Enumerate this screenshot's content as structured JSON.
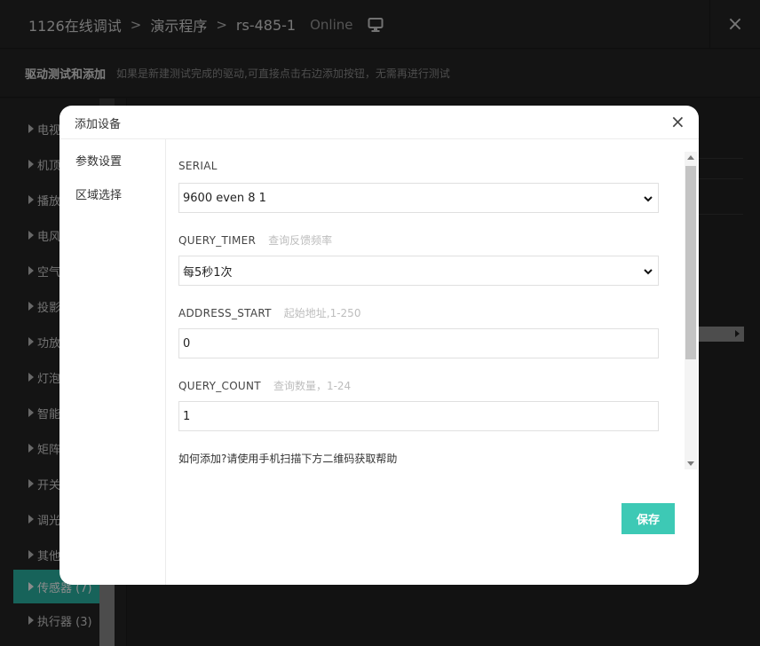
{
  "header": {
    "breadcrumb": [
      "1126在线调试",
      "演示程序",
      "rs-485-1"
    ],
    "status": "Online",
    "close_icon": "×"
  },
  "subheader": {
    "title": "驱动测试和添加",
    "hint": "如果是新建测试完成的驱动,可直接点击右边添加按钮，无需再进行测试"
  },
  "sidebar": {
    "items": [
      {
        "label": "电视"
      },
      {
        "label": "机顶"
      },
      {
        "label": "播放"
      },
      {
        "label": "电风"
      },
      {
        "label": "空气"
      },
      {
        "label": "投影"
      },
      {
        "label": "功放"
      },
      {
        "label": "灯泡"
      },
      {
        "label": "智能"
      },
      {
        "label": "矩阵"
      },
      {
        "label": "开关"
      },
      {
        "label": "调光"
      },
      {
        "label": "其他"
      },
      {
        "label": "传感器 (7)"
      },
      {
        "label": "执行器 (3)"
      }
    ],
    "active_index": 13,
    "accent_color": "#2bb5a5"
  },
  "dialog": {
    "title": "添加设备",
    "close_icon": "×",
    "nav": [
      {
        "label": "参数设置"
      },
      {
        "label": "区域选择"
      }
    ],
    "fields": {
      "serial": {
        "label": "SERIAL",
        "value": "9600 even 8 1"
      },
      "query_timer": {
        "label": "QUERY_TIMER",
        "desc": "查询反馈频率",
        "value": "每5秒1次"
      },
      "address_start": {
        "label": "ADDRESS_START",
        "desc": "起始地址,1-250",
        "value": "0"
      },
      "query_count": {
        "label": "QUERY_COUNT",
        "desc": "查询数量，1-24",
        "value": "1"
      }
    },
    "help_text": "如何添加?请使用手机扫描下方二维码获取帮助",
    "save_label": "保存",
    "save_color": "#3dc9b5"
  }
}
